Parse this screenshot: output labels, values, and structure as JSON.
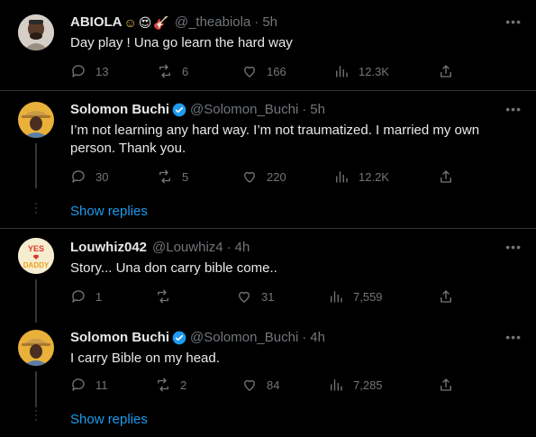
{
  "tweets": [
    {
      "name": "ABIOLA",
      "emojis": [
        "☺",
        "😍",
        "🎸"
      ],
      "handle": "@_theabiola",
      "time": "5h",
      "text": "Day play ! Una go learn the hard way",
      "replies": "13",
      "retweets": "6",
      "likes": "166",
      "views": "12.3K"
    },
    {
      "name": "Solomon Buchi",
      "verified": true,
      "handle": "@Solomon_Buchi",
      "time": "5h",
      "text": "I’m not learning any hard way. I’m not traumatized. I married my own person. Thank you.",
      "replies": "30",
      "retweets": "5",
      "likes": "220",
      "views": "12.2K"
    },
    {
      "name": "Louwhiz042",
      "handle": "@Louwhiz4",
      "time": "4h",
      "text": "Story... Una don carry bible come..",
      "replies": "1",
      "retweets": "",
      "likes": "31",
      "views": "7,559",
      "avatar_text": [
        "YES",
        "DADDY"
      ]
    },
    {
      "name": "Solomon Buchi",
      "verified": true,
      "handle": "@Solomon_Buchi",
      "time": "4h",
      "text": "I carry Bible on my head.",
      "replies": "11",
      "retweets": "2",
      "likes": "84",
      "views": "7,285"
    }
  ],
  "show_replies_label": "Show replies",
  "colors": {
    "accent": "#1d9bf0",
    "muted": "#71767b",
    "text": "#e7e9ea",
    "bg": "#000000"
  }
}
